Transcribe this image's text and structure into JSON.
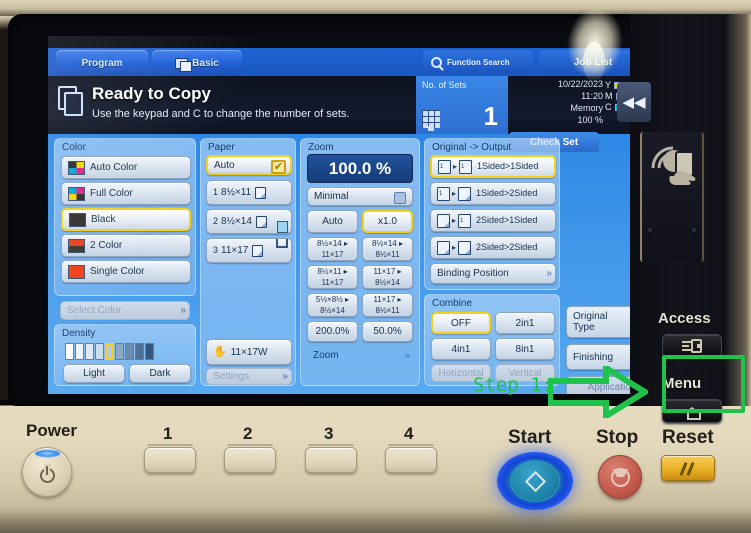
{
  "screen": {
    "tabs": [
      {
        "label": "Program",
        "icon": ""
      },
      {
        "label": "Basic",
        "icon": "copy-pages-icon"
      }
    ],
    "function_search": "Function Search",
    "job_list": "Job List",
    "status": {
      "title": "Ready to Copy",
      "subtitle": "Use the keypad and C to change the number of sets."
    },
    "sets": {
      "label": "No. of Sets",
      "value": "1"
    },
    "meta": {
      "date": "10/22/2023",
      "time": "11:20",
      "memory_label": "Memory",
      "memory_value": "100 %"
    },
    "toner": [
      {
        "label": "Y",
        "color": "#f2d400",
        "level": 100
      },
      {
        "label": "M",
        "color": "#e0218a",
        "level": 100
      },
      {
        "label": "C",
        "color": "#00a7d8",
        "level": 55
      }
    ],
    "check_set": "Check Set",
    "collapse_icon": "◀◀",
    "color_group": {
      "title": "Color",
      "options": [
        {
          "label": "Auto Color",
          "swatch": "cmyk-auto",
          "selected": false
        },
        {
          "label": "Full Color",
          "swatch": "cmyk-full",
          "selected": false
        },
        {
          "label": "Black",
          "swatch": "black",
          "selected": true
        },
        {
          "label": "2 Color",
          "swatch": "two-color",
          "selected": false
        },
        {
          "label": "Single Color",
          "swatch": "single-color",
          "selected": false
        }
      ],
      "select_color": "Select Color"
    },
    "density_group": {
      "title": "Density",
      "segments": 9,
      "current": 5,
      "light": "Light",
      "dark": "Dark"
    },
    "paper_group": {
      "title": "Paper",
      "auto": "Auto",
      "trays": [
        {
          "num": "1",
          "size": "8½×11",
          "mark": ""
        },
        {
          "num": "2",
          "size": "8½×14",
          "mark": "tray-status-icon"
        },
        {
          "num": "3",
          "size": "11×17",
          "mark": "tray-empty-icon"
        }
      ],
      "bypass": "11×17W",
      "settings": "Settings"
    },
    "zoom_group": {
      "title": "Zoom",
      "value": "100.0 %",
      "minimal": "Minimal",
      "auto": "Auto",
      "x1": "x1.0",
      "presets": [
        "8½×14 ▸\n11×17",
        "8½×14 ▸\n8½×11",
        "8½×11 ▸\n11×17",
        "11×17 ▸\n8½×14",
        "5½×8½ ▸\n8½×14",
        "11×17 ▸\n8½×11"
      ],
      "p200": "200.0%",
      "p50": "50.0%",
      "more": "Zoom"
    },
    "duplex_group": {
      "title": "Original -> Output",
      "options": [
        {
          "label": "1Sided>1Sided",
          "selected": true
        },
        {
          "label": "1Sided>2Sided",
          "selected": false
        },
        {
          "label": "2Sided>1Sided",
          "selected": false
        },
        {
          "label": "2Sided>2Sided",
          "selected": false
        }
      ],
      "binding": "Binding Position"
    },
    "combine_group": {
      "title": "Combine",
      "options": [
        {
          "label": "OFF",
          "selected": true
        },
        {
          "label": "2in1",
          "selected": false
        },
        {
          "label": "4in1",
          "selected": false
        },
        {
          "label": "8in1",
          "selected": false
        }
      ],
      "horizontal": "Horizontal",
      "vertical": "Vertical"
    },
    "right_column": {
      "original_type": "Original\nType",
      "finishing": "Finishing",
      "application": "Application"
    }
  },
  "hardware": {
    "power": "Power",
    "numbered_keys": [
      "1",
      "2",
      "3",
      "4"
    ],
    "start": "Start",
    "stop": "Stop",
    "reset": "Reset",
    "access": "Access",
    "menu": "Menu"
  },
  "annotation": {
    "step_label": "Step 1:",
    "arrow_color": "#1fc24a",
    "highlight_color": "#1fc24a"
  }
}
